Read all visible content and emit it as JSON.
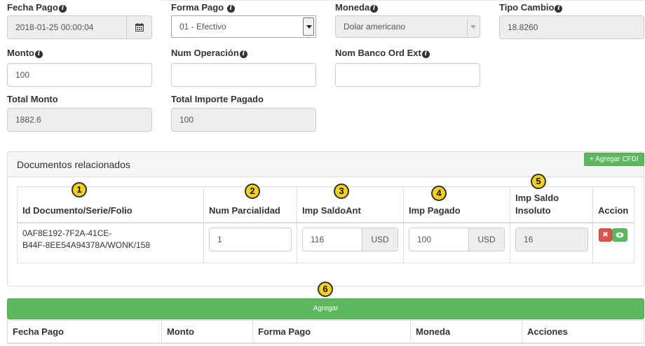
{
  "form": {
    "fecha_pago": {
      "label": "Fecha Pago",
      "value": "2018-01-25 00:00:04"
    },
    "forma_pago": {
      "label": "Forma Pago",
      "value": "01 - Efectivo"
    },
    "moneda": {
      "label": "Moneda",
      "value": "Dolar americano"
    },
    "tipo_cambio": {
      "label": "Tipo Cambio",
      "value": "18.8260"
    },
    "monto": {
      "label": "Monto",
      "value": "100"
    },
    "num_operacion": {
      "label": "Num Operación",
      "value": ""
    },
    "nom_banco": {
      "label": "Nom Banco Ord Ext",
      "value": ""
    },
    "total_monto": {
      "label": "Total Monto",
      "value": "1882.6"
    },
    "total_importe": {
      "label": "Total Importe Pagado",
      "value": "100"
    }
  },
  "documentos": {
    "title": "Documentos relacionados",
    "add_button": "+ Agregar CFDI",
    "headers": {
      "id_documento": "Id Documento/Serie/Folio",
      "num_parcialidad": "Num Parcialidad",
      "imp_saldo_ant": "Imp SaldoAnt",
      "imp_pagado": "Imp Pagado",
      "imp_saldo_insoluto": "Imp Saldo Insoluto",
      "accion": "Accion"
    },
    "row": {
      "id_line1": "0AF8E192-7F2A-41CE-",
      "id_line2": "B44F-8EE54A94378A/WONK/158",
      "num_parcialidad": "1",
      "imp_saldo_ant": "116",
      "imp_saldo_ant_currency": "USD",
      "imp_pagado": "100",
      "imp_pagado_currency": "USD",
      "imp_saldo_insoluto": "16"
    }
  },
  "markers": [
    "1",
    "2",
    "3",
    "4",
    "5",
    "6"
  ],
  "agregar_button": "Agregar",
  "pagos_table": {
    "headers": [
      "Fecha Pago",
      "Monto",
      "Forma Pago",
      "Moneda",
      "Acciones"
    ]
  },
  "colors": {
    "success": "#5cb85c",
    "danger": "#d9534f",
    "marker": "#f7d117"
  },
  "icons": {
    "calendar": "calendar-icon",
    "info": "info-circle-icon",
    "delete": "remove-icon",
    "view": "eye-icon"
  }
}
